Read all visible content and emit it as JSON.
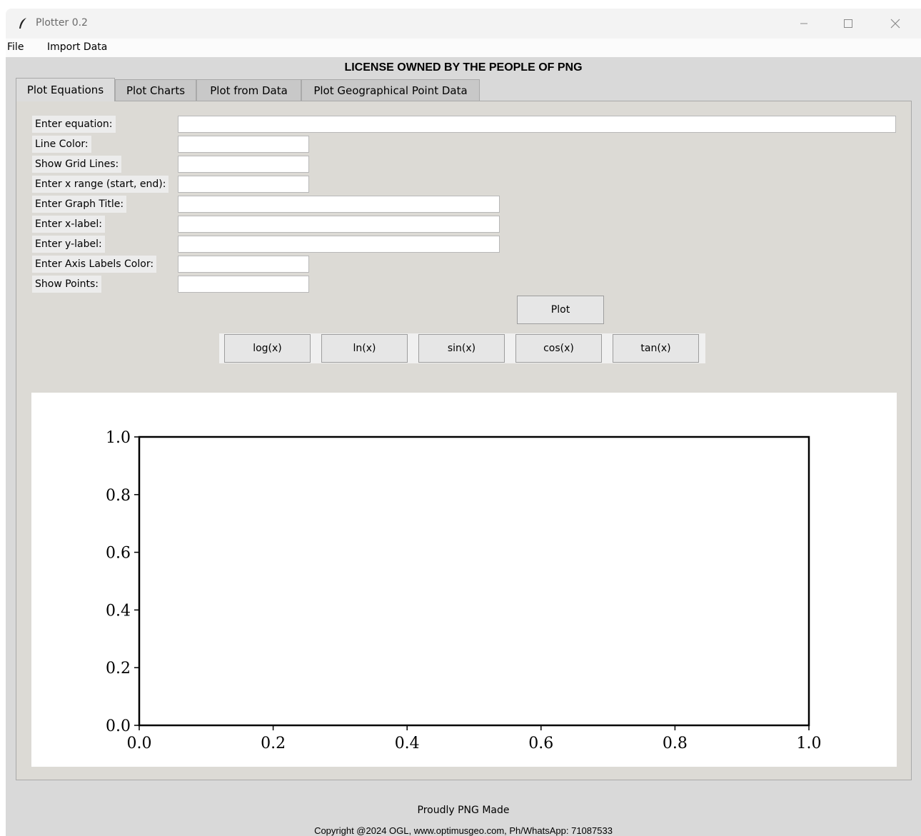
{
  "window": {
    "title": "Plotter 0.2",
    "minimize_icon": "minimize-icon",
    "maximize_icon": "maximize-icon",
    "close_icon": "close-icon"
  },
  "menu": [
    "File",
    "Import Data"
  ],
  "license_banner": "LICENSE OWNED BY THE PEOPLE OF PNG",
  "tabs": [
    "Plot Equations",
    "Plot Charts",
    "Plot from Data",
    "Plot Geographical Point Data"
  ],
  "form": {
    "fields": [
      {
        "label": "Enter equation:",
        "value": ""
      },
      {
        "label": "Line Color:",
        "value": ""
      },
      {
        "label": "Show Grid Lines:",
        "value": ""
      },
      {
        "label": "Enter x range (start, end):",
        "value": ""
      },
      {
        "label": "Enter Graph Title:",
        "value": ""
      },
      {
        "label": "Enter x-label:",
        "value": ""
      },
      {
        "label": "Enter y-label:",
        "value": ""
      },
      {
        "label": "Enter Axis Labels Color:",
        "value": ""
      },
      {
        "label": "Show Points:",
        "value": ""
      }
    ],
    "plot_button": "Plot",
    "function_buttons": [
      "log(x)",
      "ln(x)",
      "sin(x)",
      "cos(x)",
      "tan(x)"
    ]
  },
  "chart_data": {
    "type": "line",
    "series": [],
    "title": "",
    "xlabel": "",
    "ylabel": "",
    "xlim": [
      0.0,
      1.0
    ],
    "ylim": [
      0.0,
      1.0
    ],
    "x_ticks": [
      "0.0",
      "0.2",
      "0.4",
      "0.6",
      "0.8",
      "1.0"
    ],
    "y_ticks": [
      "0.0",
      "0.2",
      "0.4",
      "0.6",
      "0.8",
      "1.0"
    ],
    "grid": false
  },
  "footer": {
    "line1": "Proudly PNG Made",
    "line2": "Copyright @2024 OGL, www.optimusgeo.com, Ph/WhatsApp: 71087533"
  }
}
